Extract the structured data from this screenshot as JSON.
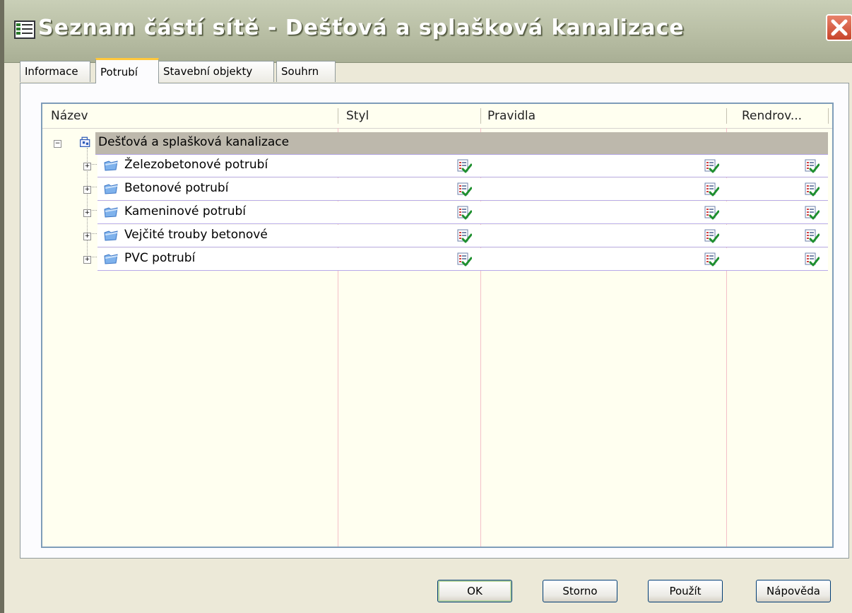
{
  "window": {
    "title": "Seznam částí sítě - Dešťová a splašková kanalizace"
  },
  "tabs": [
    {
      "label": "Informace",
      "active": false
    },
    {
      "label": "Potrubí",
      "active": true
    },
    {
      "label": "Stavební objekty",
      "active": false
    },
    {
      "label": "Souhrn",
      "active": false
    }
  ],
  "grid": {
    "columns": [
      "Název",
      "Styl",
      "Pravidla",
      "Rendrov..."
    ],
    "root": {
      "label": "Dešťová a splašková kanalizace",
      "icon": "network-icon",
      "expanded": true,
      "selected": true
    },
    "rows": [
      {
        "label": "Železobetonové potrubí",
        "icon": "folder-icon",
        "styl": "checklist-icon",
        "pravidla": "checklist-icon",
        "rendrov": "checklist-icon"
      },
      {
        "label": "Betonové potrubí",
        "icon": "folder-icon",
        "styl": "checklist-icon",
        "pravidla": "checklist-icon",
        "rendrov": "checklist-icon"
      },
      {
        "label": "Kameninové potrubí",
        "icon": "folder-icon",
        "styl": "checklist-icon",
        "pravidla": "checklist-icon",
        "rendrov": "checklist-icon"
      },
      {
        "label": "Vejčité trouby betonové",
        "icon": "folder-icon",
        "styl": "checklist-icon",
        "pravidla": "checklist-icon",
        "rendrov": "checklist-icon"
      },
      {
        "label": "PVC potrubí",
        "icon": "folder-icon",
        "styl": "checklist-icon",
        "pravidla": "checklist-icon",
        "rendrov": "checklist-icon"
      }
    ]
  },
  "buttons": {
    "ok": "OK",
    "cancel": "Storno",
    "apply": "Použít",
    "help": "Nápověda"
  },
  "colors": {
    "selected_row": "#BDB8AC",
    "tab_highlight": "#FFC83C",
    "close_button": "#C8452B"
  }
}
